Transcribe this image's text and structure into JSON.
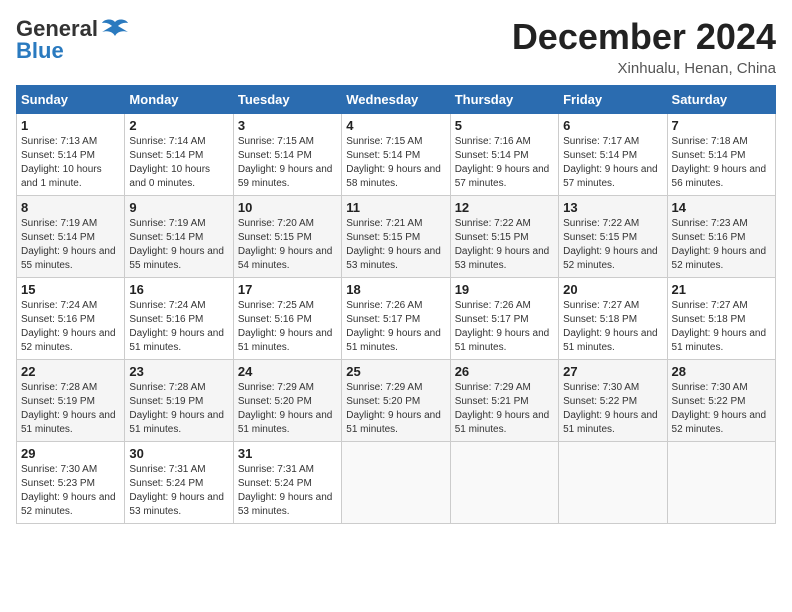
{
  "header": {
    "logo": {
      "line1": "General",
      "line2": "Blue"
    },
    "title": "December 2024",
    "subtitle": "Xinhualu, Henan, China"
  },
  "weekdays": [
    "Sunday",
    "Monday",
    "Tuesday",
    "Wednesday",
    "Thursday",
    "Friday",
    "Saturday"
  ],
  "weeks": [
    [
      {
        "day": 1,
        "sunrise": "Sunrise: 7:13 AM",
        "sunset": "Sunset: 5:14 PM",
        "daylight": "Daylight: 10 hours and 1 minute."
      },
      {
        "day": 2,
        "sunrise": "Sunrise: 7:14 AM",
        "sunset": "Sunset: 5:14 PM",
        "daylight": "Daylight: 10 hours and 0 minutes."
      },
      {
        "day": 3,
        "sunrise": "Sunrise: 7:15 AM",
        "sunset": "Sunset: 5:14 PM",
        "daylight": "Daylight: 9 hours and 59 minutes."
      },
      {
        "day": 4,
        "sunrise": "Sunrise: 7:15 AM",
        "sunset": "Sunset: 5:14 PM",
        "daylight": "Daylight: 9 hours and 58 minutes."
      },
      {
        "day": 5,
        "sunrise": "Sunrise: 7:16 AM",
        "sunset": "Sunset: 5:14 PM",
        "daylight": "Daylight: 9 hours and 57 minutes."
      },
      {
        "day": 6,
        "sunrise": "Sunrise: 7:17 AM",
        "sunset": "Sunset: 5:14 PM",
        "daylight": "Daylight: 9 hours and 57 minutes."
      },
      {
        "day": 7,
        "sunrise": "Sunrise: 7:18 AM",
        "sunset": "Sunset: 5:14 PM",
        "daylight": "Daylight: 9 hours and 56 minutes."
      }
    ],
    [
      {
        "day": 8,
        "sunrise": "Sunrise: 7:19 AM",
        "sunset": "Sunset: 5:14 PM",
        "daylight": "Daylight: 9 hours and 55 minutes."
      },
      {
        "day": 9,
        "sunrise": "Sunrise: 7:19 AM",
        "sunset": "Sunset: 5:14 PM",
        "daylight": "Daylight: 9 hours and 55 minutes."
      },
      {
        "day": 10,
        "sunrise": "Sunrise: 7:20 AM",
        "sunset": "Sunset: 5:15 PM",
        "daylight": "Daylight: 9 hours and 54 minutes."
      },
      {
        "day": 11,
        "sunrise": "Sunrise: 7:21 AM",
        "sunset": "Sunset: 5:15 PM",
        "daylight": "Daylight: 9 hours and 53 minutes."
      },
      {
        "day": 12,
        "sunrise": "Sunrise: 7:22 AM",
        "sunset": "Sunset: 5:15 PM",
        "daylight": "Daylight: 9 hours and 53 minutes."
      },
      {
        "day": 13,
        "sunrise": "Sunrise: 7:22 AM",
        "sunset": "Sunset: 5:15 PM",
        "daylight": "Daylight: 9 hours and 52 minutes."
      },
      {
        "day": 14,
        "sunrise": "Sunrise: 7:23 AM",
        "sunset": "Sunset: 5:16 PM",
        "daylight": "Daylight: 9 hours and 52 minutes."
      }
    ],
    [
      {
        "day": 15,
        "sunrise": "Sunrise: 7:24 AM",
        "sunset": "Sunset: 5:16 PM",
        "daylight": "Daylight: 9 hours and 52 minutes."
      },
      {
        "day": 16,
        "sunrise": "Sunrise: 7:24 AM",
        "sunset": "Sunset: 5:16 PM",
        "daylight": "Daylight: 9 hours and 51 minutes."
      },
      {
        "day": 17,
        "sunrise": "Sunrise: 7:25 AM",
        "sunset": "Sunset: 5:16 PM",
        "daylight": "Daylight: 9 hours and 51 minutes."
      },
      {
        "day": 18,
        "sunrise": "Sunrise: 7:26 AM",
        "sunset": "Sunset: 5:17 PM",
        "daylight": "Daylight: 9 hours and 51 minutes."
      },
      {
        "day": 19,
        "sunrise": "Sunrise: 7:26 AM",
        "sunset": "Sunset: 5:17 PM",
        "daylight": "Daylight: 9 hours and 51 minutes."
      },
      {
        "day": 20,
        "sunrise": "Sunrise: 7:27 AM",
        "sunset": "Sunset: 5:18 PM",
        "daylight": "Daylight: 9 hours and 51 minutes."
      },
      {
        "day": 21,
        "sunrise": "Sunrise: 7:27 AM",
        "sunset": "Sunset: 5:18 PM",
        "daylight": "Daylight: 9 hours and 51 minutes."
      }
    ],
    [
      {
        "day": 22,
        "sunrise": "Sunrise: 7:28 AM",
        "sunset": "Sunset: 5:19 PM",
        "daylight": "Daylight: 9 hours and 51 minutes."
      },
      {
        "day": 23,
        "sunrise": "Sunrise: 7:28 AM",
        "sunset": "Sunset: 5:19 PM",
        "daylight": "Daylight: 9 hours and 51 minutes."
      },
      {
        "day": 24,
        "sunrise": "Sunrise: 7:29 AM",
        "sunset": "Sunset: 5:20 PM",
        "daylight": "Daylight: 9 hours and 51 minutes."
      },
      {
        "day": 25,
        "sunrise": "Sunrise: 7:29 AM",
        "sunset": "Sunset: 5:20 PM",
        "daylight": "Daylight: 9 hours and 51 minutes."
      },
      {
        "day": 26,
        "sunrise": "Sunrise: 7:29 AM",
        "sunset": "Sunset: 5:21 PM",
        "daylight": "Daylight: 9 hours and 51 minutes."
      },
      {
        "day": 27,
        "sunrise": "Sunrise: 7:30 AM",
        "sunset": "Sunset: 5:22 PM",
        "daylight": "Daylight: 9 hours and 51 minutes."
      },
      {
        "day": 28,
        "sunrise": "Sunrise: 7:30 AM",
        "sunset": "Sunset: 5:22 PM",
        "daylight": "Daylight: 9 hours and 52 minutes."
      }
    ],
    [
      {
        "day": 29,
        "sunrise": "Sunrise: 7:30 AM",
        "sunset": "Sunset: 5:23 PM",
        "daylight": "Daylight: 9 hours and 52 minutes."
      },
      {
        "day": 30,
        "sunrise": "Sunrise: 7:31 AM",
        "sunset": "Sunset: 5:24 PM",
        "daylight": "Daylight: 9 hours and 53 minutes."
      },
      {
        "day": 31,
        "sunrise": "Sunrise: 7:31 AM",
        "sunset": "Sunset: 5:24 PM",
        "daylight": "Daylight: 9 hours and 53 minutes."
      },
      null,
      null,
      null,
      null
    ]
  ]
}
